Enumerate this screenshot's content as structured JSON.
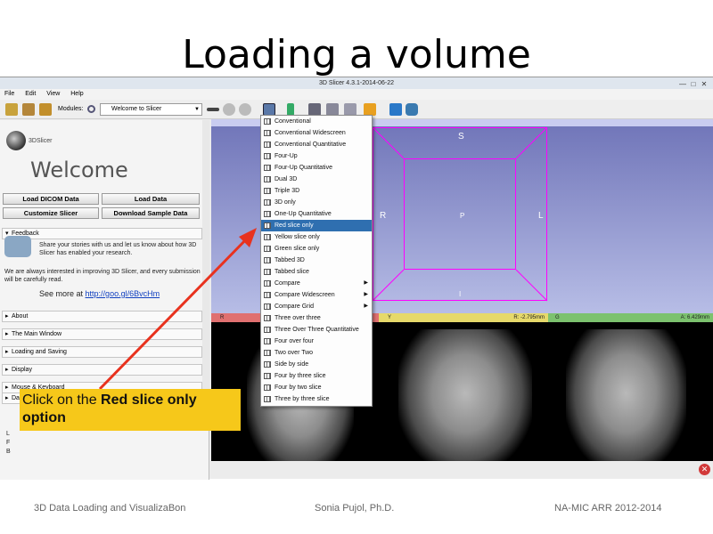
{
  "slide_title": "Loading a volume",
  "window": {
    "title": "3D Slicer 4.3.1-2014-06-22",
    "min": "—",
    "max": "□",
    "close": "✕"
  },
  "menubar": [
    "File",
    "Edit",
    "View",
    "Help"
  ],
  "toolbar": {
    "modules_label": "Modules:",
    "module_selected": "Welcome to Slicer"
  },
  "left_panel": {
    "logo_text": "3DSlicer",
    "welcome": "Welcome",
    "buttons": {
      "load_dicom": "Load DICOM Data",
      "load_data": "Load Data",
      "customize": "Customize Slicer",
      "download_sample": "Download Sample Data"
    },
    "feedback_header": "Feedback",
    "feedback_text1": "Share your stories with us and let us know about how 3D Slicer has enabled your research.",
    "feedback_text2": "We are always interested in improving 3D Slicer, and every submission will be carefully read.",
    "see_more": "See more at",
    "see_more_link": "http://goo.gl/6BvcHm",
    "sections": [
      "About",
      "The Main Window",
      "Loading and Saving",
      "Display",
      "Mouse & Keyboard",
      "Data"
    ],
    "coord_letters": [
      "L",
      "F",
      "B"
    ]
  },
  "view3d_labels": {
    "top": "S",
    "left": "R",
    "center": "P",
    "right": "L",
    "bottom": "I"
  },
  "slice_bars": {
    "red_letter": "R",
    "yellow_letter": "Y",
    "yellow_value": "R: -2.795mm",
    "green_letter": "G",
    "green_value": "A: 6.429mm"
  },
  "layout_menu": [
    {
      "label": "Conventional",
      "submenu": false,
      "selected": false
    },
    {
      "label": "Conventional Widescreen",
      "submenu": false,
      "selected": false
    },
    {
      "label": "Conventional Quantitative",
      "submenu": false,
      "selected": false
    },
    {
      "label": "Four-Up",
      "submenu": false,
      "selected": false
    },
    {
      "label": "Four-Up Quantitative",
      "submenu": false,
      "selected": false
    },
    {
      "label": "Dual 3D",
      "submenu": false,
      "selected": false
    },
    {
      "label": "Triple 3D",
      "submenu": false,
      "selected": false
    },
    {
      "label": "3D only",
      "submenu": false,
      "selected": false
    },
    {
      "label": "One-Up Quantitative",
      "submenu": false,
      "selected": false
    },
    {
      "label": "Red slice only",
      "submenu": false,
      "selected": true
    },
    {
      "label": "Yellow slice only",
      "submenu": false,
      "selected": false
    },
    {
      "label": "Green slice only",
      "submenu": false,
      "selected": false
    },
    {
      "label": "Tabbed 3D",
      "submenu": false,
      "selected": false
    },
    {
      "label": "Tabbed slice",
      "submenu": false,
      "selected": false
    },
    {
      "label": "Compare",
      "submenu": true,
      "selected": false
    },
    {
      "label": "Compare Widescreen",
      "submenu": true,
      "selected": false
    },
    {
      "label": "Compare Grid",
      "submenu": true,
      "selected": false
    },
    {
      "label": "Three over three",
      "submenu": false,
      "selected": false
    },
    {
      "label": "Three Over Three Quantitative",
      "submenu": false,
      "selected": false
    },
    {
      "label": "Four over four",
      "submenu": false,
      "selected": false
    },
    {
      "label": "Two over Two",
      "submenu": false,
      "selected": false
    },
    {
      "label": "Side by side",
      "submenu": false,
      "selected": false
    },
    {
      "label": "Four by three slice",
      "submenu": false,
      "selected": false
    },
    {
      "label": "Four by two slice",
      "submenu": false,
      "selected": false
    },
    {
      "label": "Three by three slice",
      "submenu": false,
      "selected": false
    }
  ],
  "callout": {
    "prefix": "Click on the",
    "bold": "Red slice only",
    "suffix": "option"
  },
  "footer": {
    "left": "3D Data Loading and VisualizaBon",
    "center": "Sonia Pujol, Ph.D.",
    "right": "NA-MIC ARR 2012-2014"
  },
  "colors": {
    "accent": "#2f6fb0",
    "callout": "#f6c81a",
    "arrow": "#e8321e",
    "cube": "#ff00ff"
  }
}
